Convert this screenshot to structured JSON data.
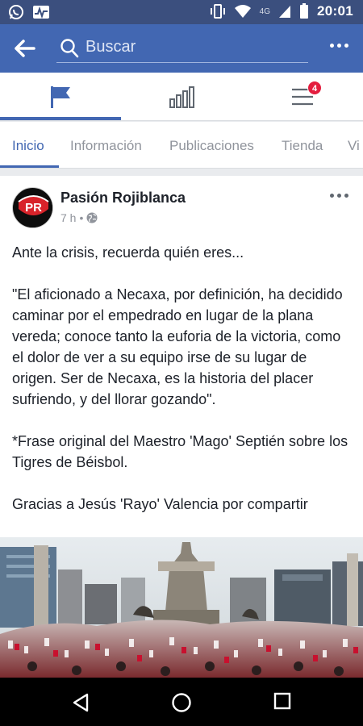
{
  "status_bar": {
    "time": "20:01",
    "network": "4G"
  },
  "app_bar": {
    "search_placeholder": "Buscar"
  },
  "top_tabs": {
    "notifications_badge": "4"
  },
  "page_tabs": [
    "Inicio",
    "Información",
    "Publicaciones",
    "Tienda",
    "Vi"
  ],
  "post": {
    "author": "Pasión Rojiblanca",
    "avatar_text": "PR",
    "time": "7 h",
    "separator": "•",
    "paragraphs": [
      "Ante la crisis, recuerda quién eres...",
      "\"El aficionado a Necaxa, por definición, ha decidido caminar por el empedrado en lugar de la plana vereda; conoce tanto la euforia de la victoria, como el dolor de ver a su equipo irse de su lugar de origen. Ser de Necaxa, es la historia del placer sufriendo, y del llorar gozando\".",
      "*Frase original del Maestro 'Mago' Septién sobre los Tigres de Béisbol.",
      "Gracias a Jesús 'Rayo' Valencia por compartir"
    ]
  },
  "colors": {
    "brand": "#4267b2",
    "status_bar": "#3b4f7e",
    "badge": "#e41e3f"
  }
}
